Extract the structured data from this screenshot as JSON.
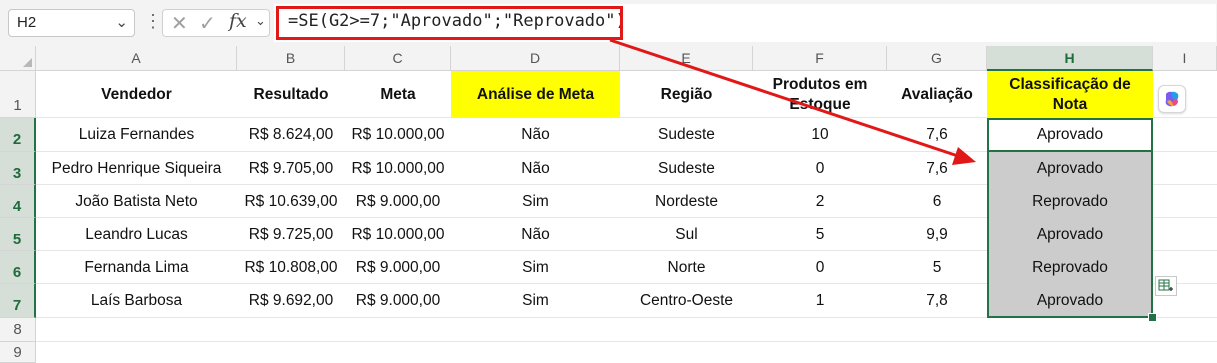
{
  "formula_bar": {
    "name_box": "H2",
    "formula": "=SE(G2>=7;\"Aprovado\";\"Reprovado\")",
    "fx_label": "fx"
  },
  "columns": [
    "A",
    "B",
    "C",
    "D",
    "E",
    "F",
    "G",
    "H",
    "I"
  ],
  "rows": [
    "1",
    "2",
    "3",
    "4",
    "5",
    "6",
    "7",
    "8",
    "9"
  ],
  "headers": {
    "vendedor": "Vendedor",
    "resultado": "Resultado",
    "meta": "Meta",
    "analise": "Análise de Meta",
    "regiao": "Região",
    "produtos_l1": "Produtos em",
    "produtos_l2": "Estoque",
    "avaliacao": "Avaliação",
    "classif_l1": "Classificação de",
    "classif_l2": "Nota"
  },
  "table": [
    {
      "vendedor": "Luiza Fernandes",
      "resultado": "R$ 8.624,00",
      "meta": "R$ 10.000,00",
      "analise": "Não",
      "regiao": "Sudeste",
      "produtos": "10",
      "avaliacao": "7,6",
      "classificacao": "Aprovado"
    },
    {
      "vendedor": "Pedro Henrique Siqueira",
      "resultado": "R$ 9.705,00",
      "meta": "R$ 10.000,00",
      "analise": "Não",
      "regiao": "Sudeste",
      "produtos": "0",
      "avaliacao": "7,6",
      "classificacao": "Aprovado"
    },
    {
      "vendedor": "João Batista Neto",
      "resultado": "R$ 10.639,00",
      "meta": "R$ 9.000,00",
      "analise": "Sim",
      "regiao": "Nordeste",
      "produtos": "2",
      "avaliacao": "6",
      "classificacao": "Reprovado"
    },
    {
      "vendedor": "Leandro Lucas",
      "resultado": "R$ 9.725,00",
      "meta": "R$ 10.000,00",
      "analise": "Não",
      "regiao": "Sul",
      "produtos": "5",
      "avaliacao": "9,9",
      "classificacao": "Aprovado"
    },
    {
      "vendedor": "Fernanda Lima",
      "resultado": "R$ 10.808,00",
      "meta": "R$ 9.000,00",
      "analise": "Sim",
      "regiao": "Norte",
      "produtos": "0",
      "avaliacao": "5",
      "classificacao": "Reprovado"
    },
    {
      "vendedor": "Laís Barbosa",
      "resultado": "R$ 9.692,00",
      "meta": "R$ 9.000,00",
      "analise": "Sim",
      "regiao": "Centro-Oeste",
      "produtos": "1",
      "avaliacao": "7,8",
      "classificacao": "Aprovado"
    }
  ],
  "colors": {
    "highlight_yellow": "#ffff00",
    "selection_green": "#217346",
    "annotation_red": "#e01818",
    "cell_gray": "#cccccc"
  },
  "icons": [
    "chevron-down-icon",
    "more-vertical-icon",
    "cancel-icon",
    "confirm-icon",
    "insert-function-icon",
    "select-all-icon",
    "copilot-icon",
    "quick-analysis-icon",
    "annotation-arrow-icon"
  ]
}
